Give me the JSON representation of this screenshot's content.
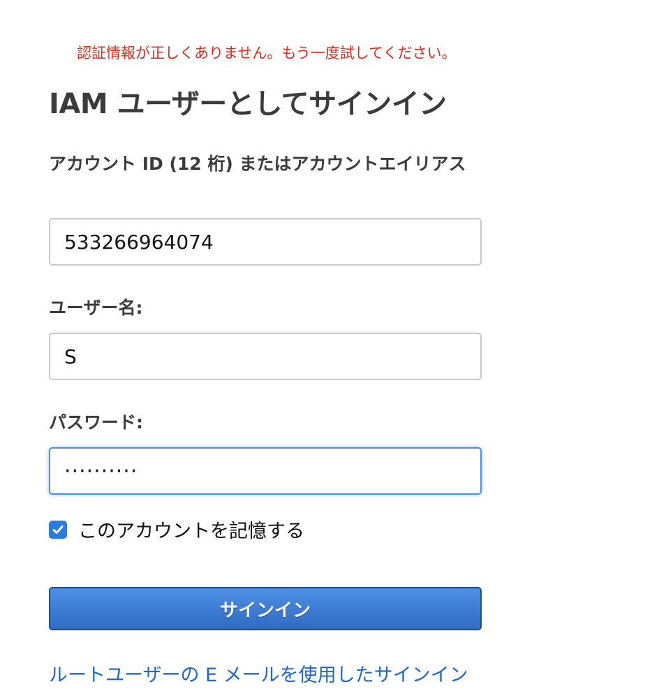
{
  "error_message": "認証情報が正しくありません。もう一度試してください。",
  "title": "IAM ユーザーとしてサインイン",
  "account": {
    "label": "アカウント ID (12 桁) またはアカウントエイリアス",
    "value": "533266964074"
  },
  "username": {
    "label": "ユーザー名:",
    "value": "S"
  },
  "password": {
    "label": "パスワード:",
    "masked_value": "··········"
  },
  "remember": {
    "label": "このアカウントを記憶する",
    "checked": true
  },
  "signin_button": "サインイン",
  "root_signin_link": "ルートユーザーの E メールを使用したサインイン",
  "colors": {
    "error": "#e02a1c",
    "button": "#2f6cc4",
    "link": "#1f67c8",
    "focus": "#4d8fe0"
  }
}
